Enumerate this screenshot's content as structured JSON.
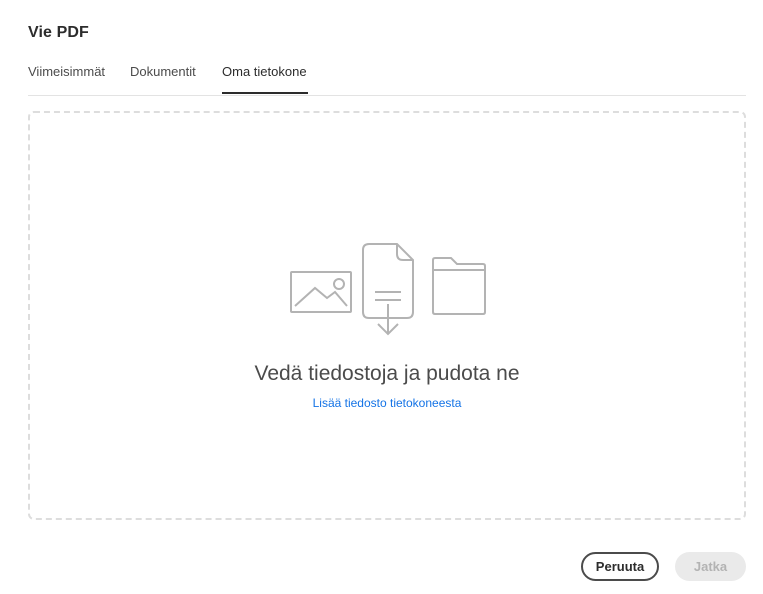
{
  "dialog": {
    "title": "Vie PDF"
  },
  "tabs": [
    {
      "label": "Viimeisimmät",
      "active": false
    },
    {
      "label": "Dokumentit",
      "active": false
    },
    {
      "label": "Oma tietokone",
      "active": true
    }
  ],
  "dropzone": {
    "title": "Vedä tiedostoja ja pudota ne",
    "link": "Lisää tiedosto tietokoneesta",
    "icons": [
      "image-icon",
      "document-download-icon",
      "folder-icon"
    ]
  },
  "buttons": {
    "cancel": "Peruuta",
    "continue": "Jatka"
  },
  "colors": {
    "link": "#1473e6",
    "text": "#2c2c2c",
    "disabled_bg": "#eaeaea",
    "disabled_text": "#b3b3b3",
    "border_dashed": "#dddddd"
  }
}
